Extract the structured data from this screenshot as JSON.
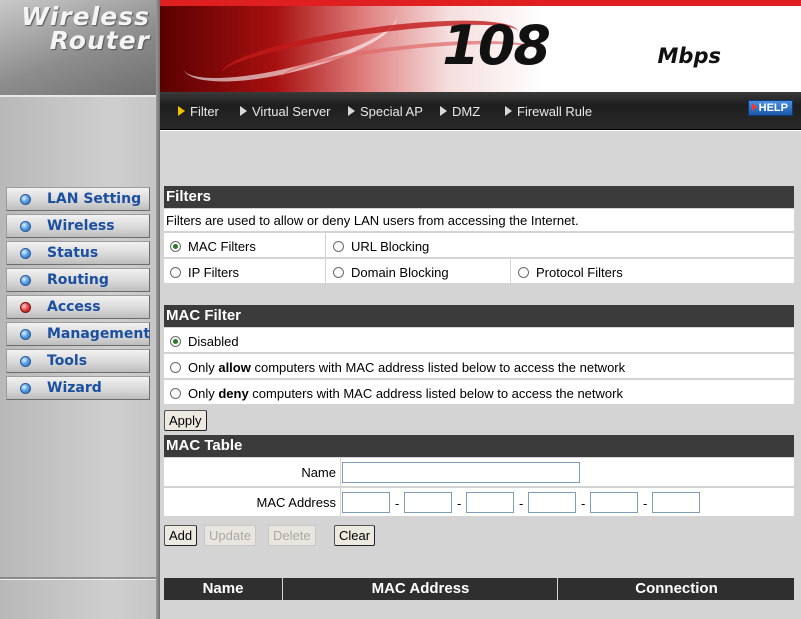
{
  "logo": {
    "line1": "Wireless",
    "line2": "Router"
  },
  "banner": {
    "speed": "108",
    "unit": "Mbps"
  },
  "tabs": [
    {
      "label": "Filter",
      "active": true
    },
    {
      "label": "Virtual Server",
      "active": false
    },
    {
      "label": "Special AP",
      "active": false
    },
    {
      "label": "DMZ",
      "active": false
    },
    {
      "label": "Firewall Rule",
      "active": false
    }
  ],
  "help_label": "HELP",
  "sidebar": {
    "items": [
      {
        "label": "LAN Setting",
        "active": false
      },
      {
        "label": "Wireless",
        "active": false
      },
      {
        "label": "Status",
        "active": false
      },
      {
        "label": "Routing",
        "active": false
      },
      {
        "label": "Access",
        "active": true
      },
      {
        "label": "Management",
        "active": false
      },
      {
        "label": "Tools",
        "active": false
      },
      {
        "label": "Wizard",
        "active": false
      }
    ]
  },
  "filters": {
    "title": "Filters",
    "description": "Filters are used to allow or deny LAN users from accessing the Internet.",
    "options": {
      "mac": "MAC Filters",
      "url": "URL Blocking",
      "ip": "IP Filters",
      "domain": "Domain Blocking",
      "protocol": "Protocol Filters"
    },
    "selected": "mac"
  },
  "mac_filter": {
    "title": "MAC Filter",
    "disabled_label": "Disabled",
    "allow": {
      "pre": "Only ",
      "bold": "allow",
      "post": " computers with MAC address listed below to access the network"
    },
    "deny": {
      "pre": "Only ",
      "bold": "deny",
      "post": " computers with MAC address listed below to access the network"
    },
    "selected": "disabled",
    "apply_label": "Apply"
  },
  "mac_table": {
    "title": "MAC Table",
    "name_label": "Name",
    "name_value": "",
    "mac_label": "MAC Address",
    "mac_octets": [
      "",
      "",
      "",
      "",
      "",
      ""
    ],
    "separator": "-",
    "buttons": {
      "add": "Add",
      "update": "Update",
      "delete": "Delete",
      "clear": "Clear"
    },
    "columns": [
      "Name",
      "MAC Address",
      "Connection"
    ]
  },
  "colors": {
    "header_bg": "#3b3b3b",
    "content_bg": "#d4d4d4",
    "nav_label": "#1b4fa0",
    "banner_red": "#e02020"
  }
}
